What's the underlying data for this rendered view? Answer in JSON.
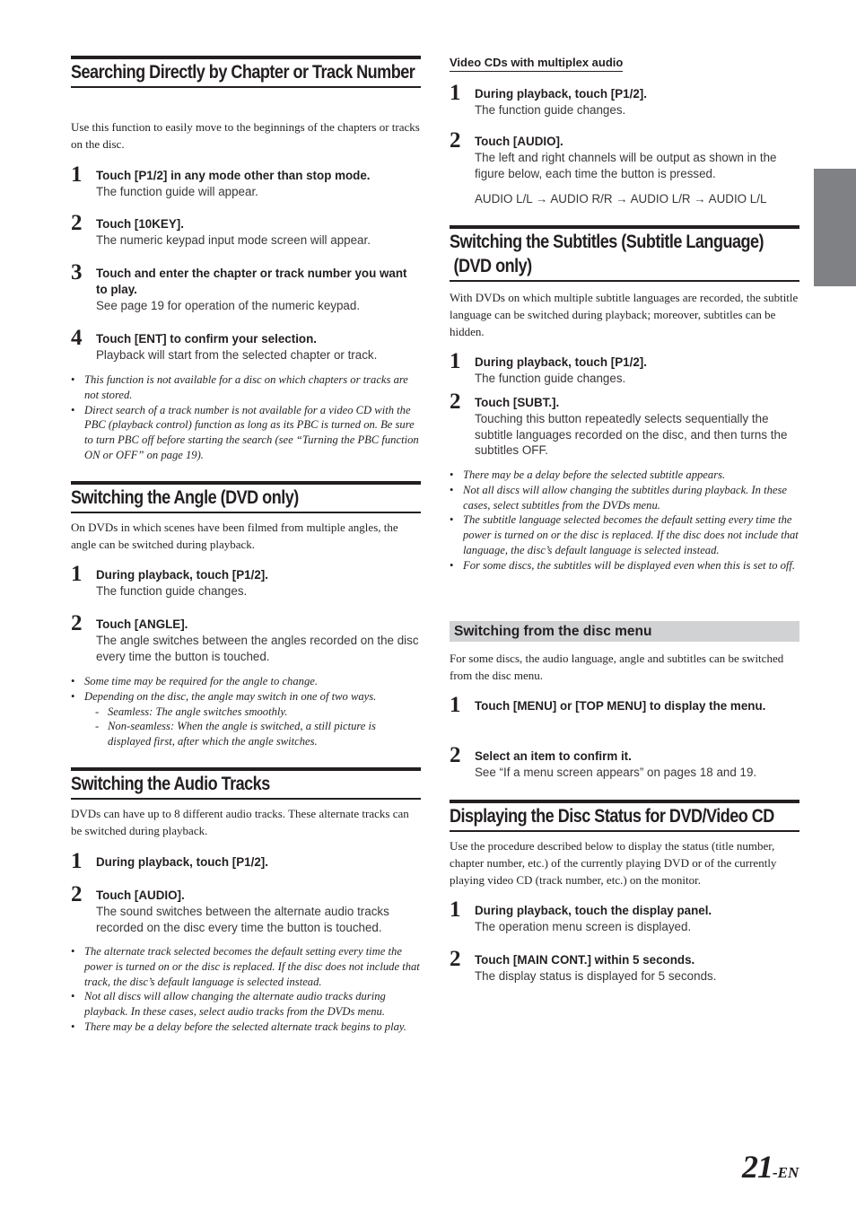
{
  "left": {
    "search": {
      "heading": "Searching Directly by Chapter or Track Number",
      "intro": "Use this function to easily move to the beginnings of the chapters or tracks on the disc.",
      "steps": [
        {
          "num": "1",
          "title": "Touch [P1/2] in any mode other than stop mode.",
          "desc": "The function guide will appear."
        },
        {
          "num": "2",
          "title": "Touch [10KEY].",
          "desc": "The numeric keypad input mode screen will appear."
        },
        {
          "num": "3",
          "title": "Touch and enter the chapter or track number you want to play.",
          "desc": "See page 19 for operation of the numeric keypad."
        },
        {
          "num": "4",
          "title": "Touch [ENT] to confirm your selection.",
          "desc": "Playback will start from the selected chapter or track."
        }
      ],
      "notes": [
        "This function is not available for a disc on which chapters or tracks are not stored.",
        "Direct search of a track number is not available for a video CD with the PBC (playback control) function as long as its PBC is turned on. Be sure to turn PBC off before starting the search (see “Turning the PBC function ON or OFF” on page 19)."
      ]
    },
    "angle": {
      "heading": "Switching the Angle (DVD only)",
      "intro": "On DVDs in which scenes have been filmed from multiple angles, the angle can be switched during playback.",
      "steps": [
        {
          "num": "1",
          "title": "During playback, touch [P1/2].",
          "desc": "The function guide changes."
        },
        {
          "num": "2",
          "title": "Touch [ANGLE].",
          "desc": "The angle switches between the angles recorded on the disc every time the button is touched."
        }
      ],
      "notes": [
        "Some time may be required for the angle to change.",
        "Depending on the disc, the angle may switch in one of two ways."
      ],
      "subnotes": [
        "Seamless:  The angle switches smoothly.",
        "Non-seamless:  When the angle is switched, a still picture is displayed first, after which the angle switches."
      ]
    },
    "audio": {
      "heading": "Switching the Audio Tracks",
      "intro": "DVDs can have up to 8 different audio tracks. These alternate tracks can be switched during playback.",
      "steps": [
        {
          "num": "1",
          "title": "During playback, touch [P1/2].",
          "desc": ""
        },
        {
          "num": "2",
          "title": "Touch [AUDIO].",
          "desc": "The sound switches between the alternate audio tracks recorded on the disc every time the button is touched."
        }
      ],
      "notes": [
        "The alternate track selected becomes the default setting every time the power is turned on or the disc is replaced. If the disc does not include that track, the disc’s default language is selected instead.",
        "Not all discs will allow changing the alternate audio tracks during playback. In these cases, select audio tracks from the DVDs menu.",
        "There may be a delay before the selected alternate track begins to play."
      ]
    }
  },
  "right": {
    "vcd": {
      "subheading": "Video CDs with multiplex audio",
      "steps": [
        {
          "num": "1",
          "title": "During playback, touch [P1/2].",
          "desc": "The function guide changes."
        },
        {
          "num": "2",
          "title": "Touch [AUDIO].",
          "desc": "The left and right channels will be output as shown in the figure below, each time the button is pressed."
        }
      ],
      "sequence": "AUDIO L/L → AUDIO R/R → AUDIO L/R → AUDIO L/L"
    },
    "subtitles": {
      "heading_line1": "Switching the Subtitles (Subtitle Language)",
      "heading_line2": " (DVD only)",
      "intro": "With DVDs on which multiple subtitle languages are recorded, the subtitle language can be switched during playback; moreover, subtitles can be hidden.",
      "steps": [
        {
          "num": "1",
          "title": "During playback, touch [P1/2].",
          "desc": "The function guide changes."
        },
        {
          "num": "2",
          "title": "Touch [SUBT.].",
          "desc": "Touching this button repeatedly selects sequentially the subtitle languages recorded on the disc, and then turns the subtitles OFF."
        }
      ],
      "notes": [
        "There may be a delay before the selected subtitle appears.",
        "Not all discs will allow changing the subtitles during playback. In these cases, select subtitles from the DVDs menu.",
        "The subtitle language selected becomes the default setting every time the power is turned on or the disc is replaced. If the disc does not include that language, the disc’s default language is selected instead.",
        "For some discs, the subtitles will be displayed even when this is set to off."
      ]
    },
    "discmenu": {
      "subheading": "Switching from the disc menu",
      "intro": "For some discs, the audio language, angle and subtitles can be switched from the disc menu.",
      "steps": [
        {
          "num": "1",
          "title": "Touch [MENU] or [TOP MENU] to display the menu.",
          "desc": ""
        },
        {
          "num": "2",
          "title": "Select an item to confirm it.",
          "desc": "See “If a menu screen appears” on pages 18 and 19."
        }
      ]
    },
    "status": {
      "heading": "Displaying the Disc Status for DVD/Video CD",
      "intro": "Use the procedure described below to display the status (title number, chapter number, etc.) of the currently playing DVD or of the currently playing video CD (track number, etc.) on the monitor.",
      "steps": [
        {
          "num": "1",
          "title": "During playback, touch the display panel.",
          "desc": "The operation menu screen is displayed."
        },
        {
          "num": "2",
          "title": "Touch [MAIN CONT.] within 5 seconds.",
          "desc": "The display status is displayed for 5 seconds."
        }
      ]
    }
  },
  "bullet_glyph": "•",
  "dash_glyph": "-",
  "page": {
    "number": "21",
    "suffix": "-EN"
  },
  "colors": {
    "text": "#231f20",
    "side_tab": "#808184",
    "subhead_band": "#d1d2d4"
  }
}
